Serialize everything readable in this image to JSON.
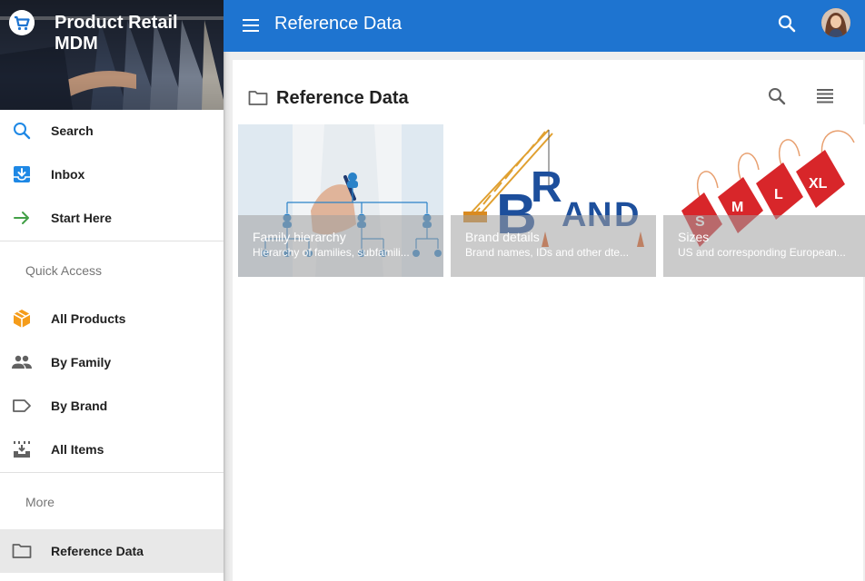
{
  "app": {
    "title": "Product Retail MDM"
  },
  "sidebar": {
    "items_top": [
      {
        "label": "Search",
        "icon": "search-icon"
      },
      {
        "label": "Inbox",
        "icon": "inbox-icon"
      },
      {
        "label": "Start Here",
        "icon": "arrow-forward-icon"
      }
    ],
    "quick_access_header": "Quick Access",
    "quick_access": [
      {
        "label": "All Products",
        "icon": "cube-icon"
      },
      {
        "label": "By Family",
        "icon": "people-icon"
      },
      {
        "label": "By Brand",
        "icon": "label-icon"
      },
      {
        "label": "All Items",
        "icon": "items-icon"
      }
    ],
    "more_header": "More",
    "more": [
      {
        "label": "Reference Data",
        "icon": "folder-icon",
        "active": true
      }
    ]
  },
  "topbar": {
    "title": "Reference Data"
  },
  "content": {
    "title": "Reference Data",
    "tiles": [
      {
        "title": "Family hierarchy",
        "subtitle": "Hierarchy of families, subfamili..."
      },
      {
        "title": "Brand details",
        "subtitle": "Brand names, IDs and other dte..."
      },
      {
        "title": "Sizes",
        "subtitle": "US and corresponding European..."
      }
    ]
  },
  "colors": {
    "primary": "#1e74d0",
    "accent_orange": "#f59c1a",
    "accent_green": "#43a047",
    "accent_blue": "#1e88e5"
  }
}
